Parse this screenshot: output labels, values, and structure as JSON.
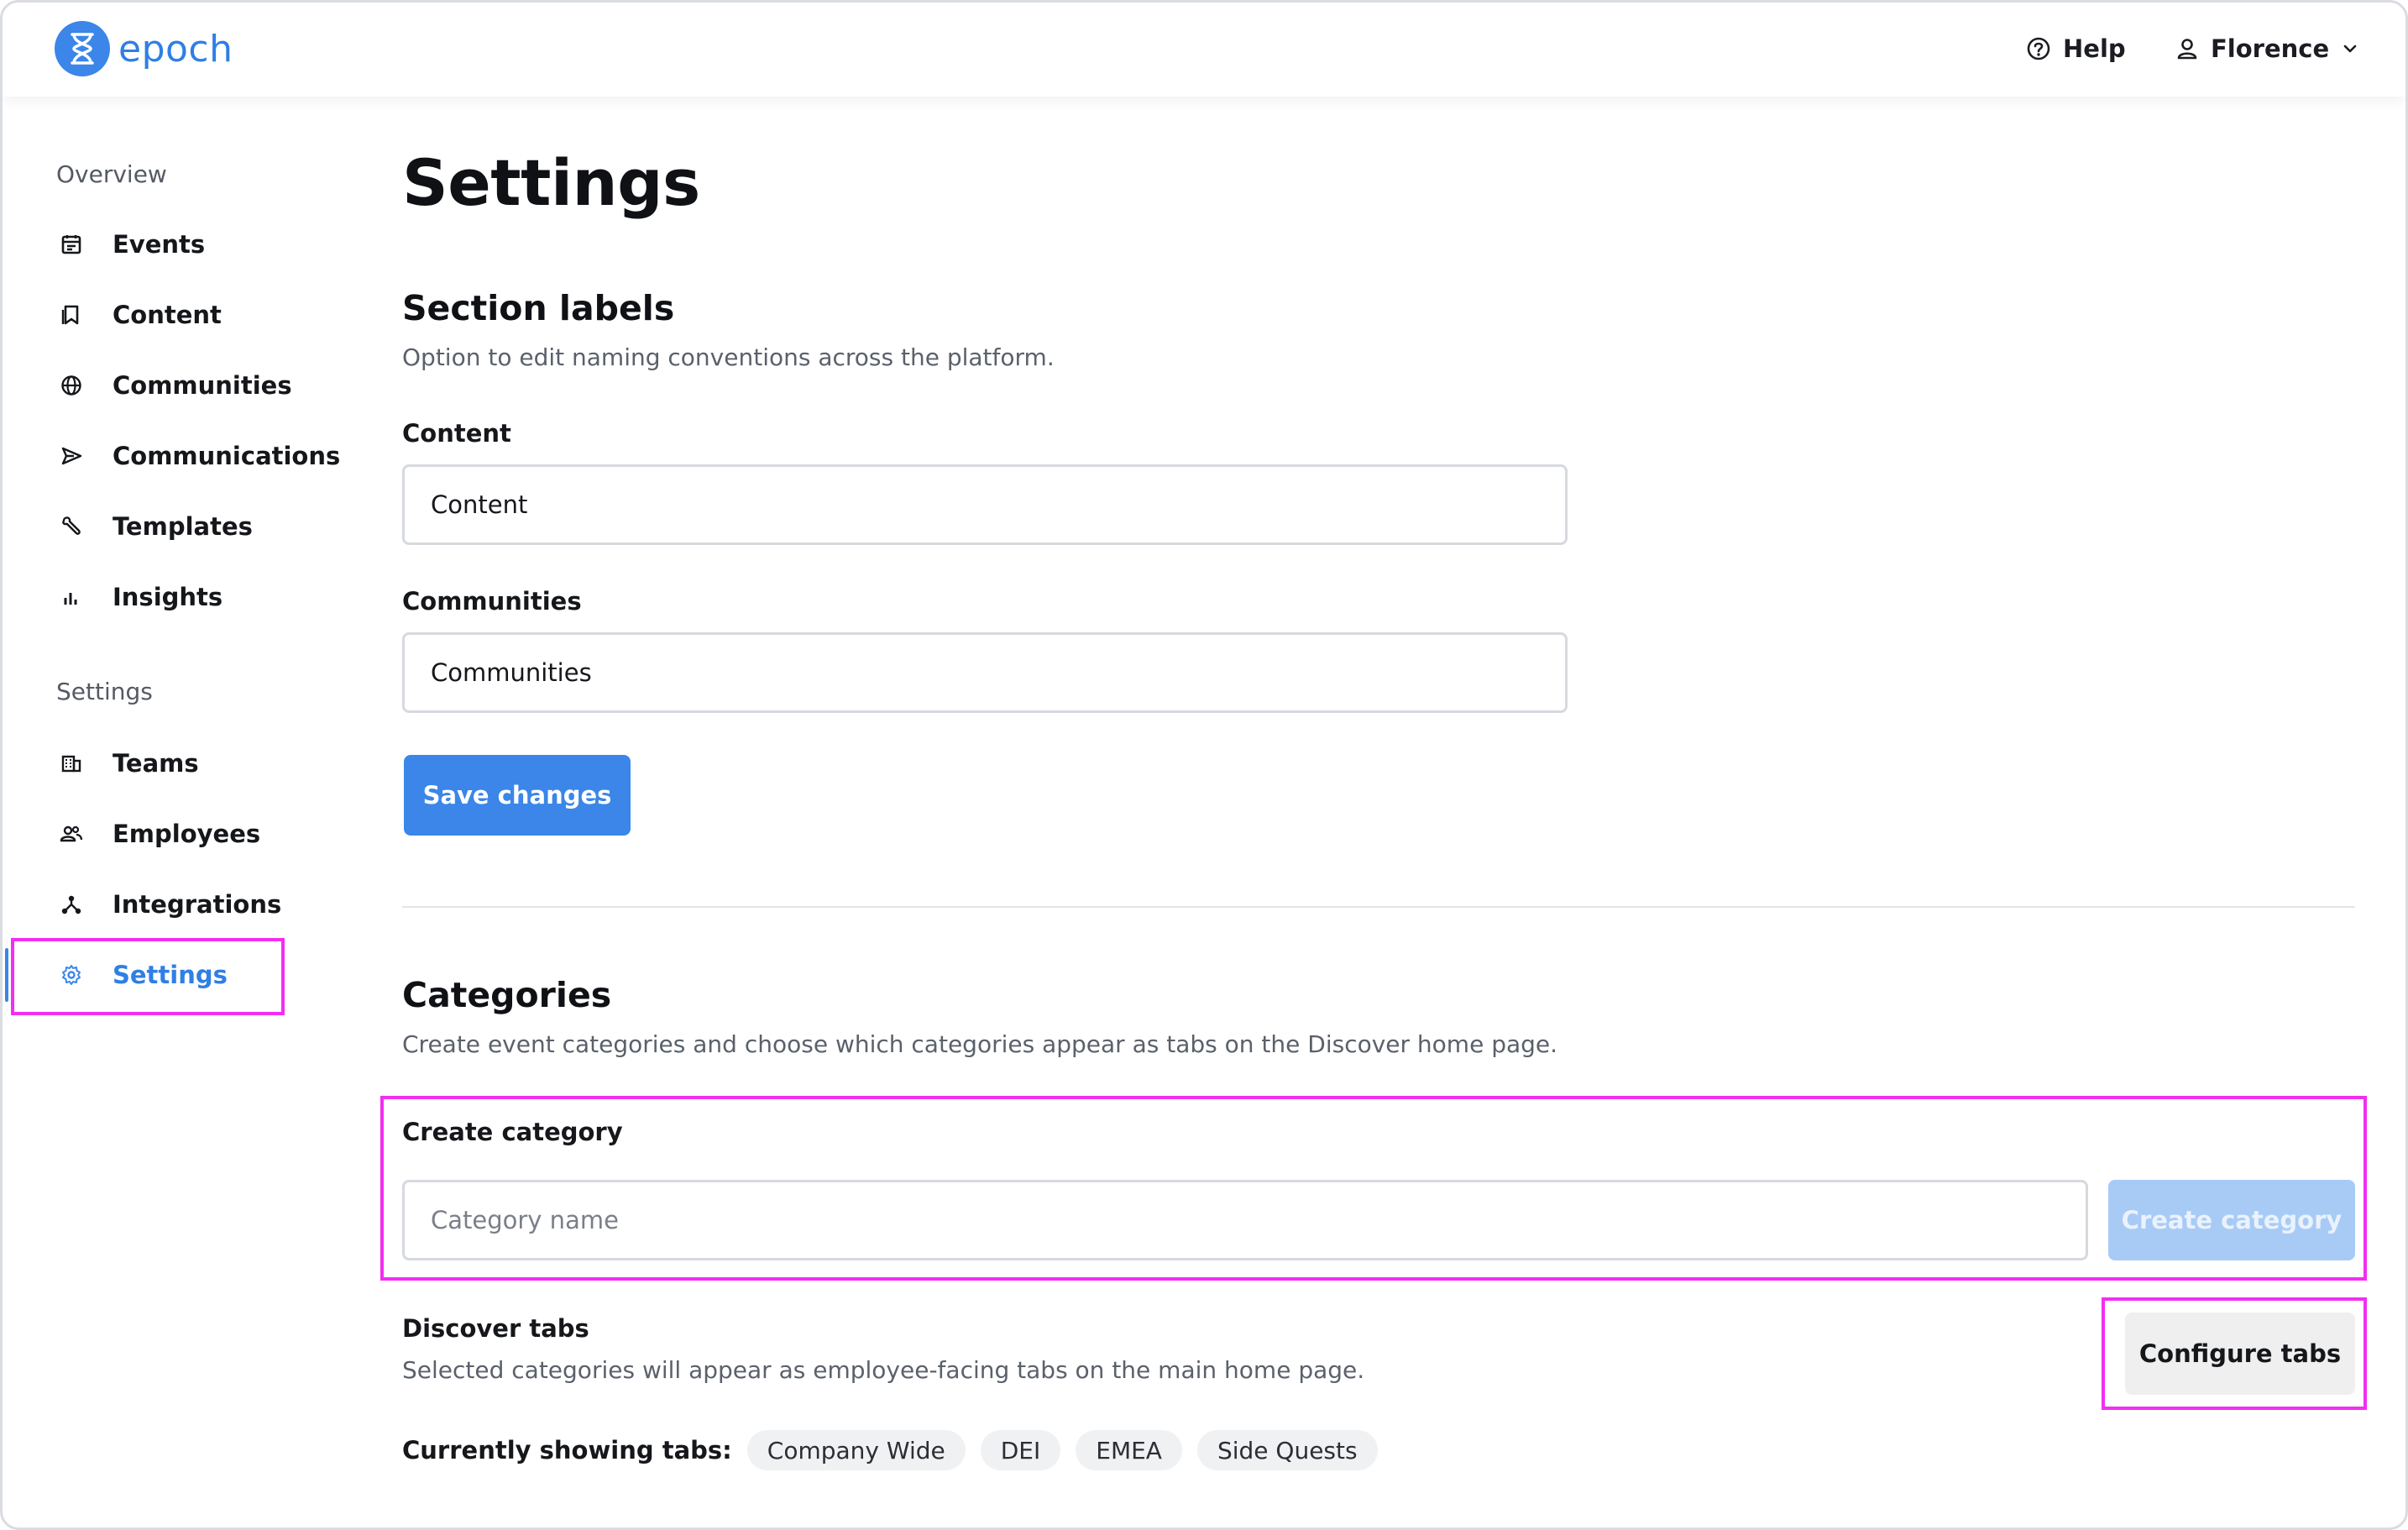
{
  "app": {
    "logo_text": "epoch"
  },
  "header": {
    "help_label": "Help",
    "user_name": "Florence"
  },
  "sidebar": {
    "overview_heading": "Overview",
    "overview_items": [
      {
        "label": "Events",
        "icon": "calendar-icon"
      },
      {
        "label": "Content",
        "icon": "bookmark-icon"
      },
      {
        "label": "Communities",
        "icon": "globe-icon"
      },
      {
        "label": "Communications",
        "icon": "send-icon"
      },
      {
        "label": "Templates",
        "icon": "wrench-icon"
      },
      {
        "label": "Insights",
        "icon": "bar-chart-icon"
      }
    ],
    "settings_heading": "Settings",
    "settings_items": [
      {
        "label": "Teams",
        "icon": "building-icon"
      },
      {
        "label": "Employees",
        "icon": "people-icon"
      },
      {
        "label": "Integrations",
        "icon": "network-icon"
      },
      {
        "label": "Settings",
        "icon": "gear-icon",
        "active": true
      }
    ]
  },
  "main": {
    "page_title": "Settings",
    "section_labels": {
      "title": "Section labels",
      "description": "Option to edit naming conventions across the platform.",
      "content_label": "Content",
      "content_value": "Content",
      "communities_label": "Communities",
      "communities_value": "Communities",
      "save_label": "Save changes"
    },
    "categories": {
      "title": "Categories",
      "description": "Create event categories and choose which categories appear as tabs on the Discover home page.",
      "create_label": "Create category",
      "create_placeholder": "Category name",
      "create_button": "Create category",
      "discover_title": "Discover tabs",
      "discover_description": "Selected categories will appear as employee-facing tabs on the main home page.",
      "configure_button": "Configure tabs",
      "showing_label": "Currently showing tabs:",
      "tabs": [
        "Company Wide",
        "DEI",
        "EMEA",
        "Side Quests"
      ]
    }
  },
  "colors": {
    "accent": "#3b86e8",
    "highlight": "#f22ef2"
  }
}
